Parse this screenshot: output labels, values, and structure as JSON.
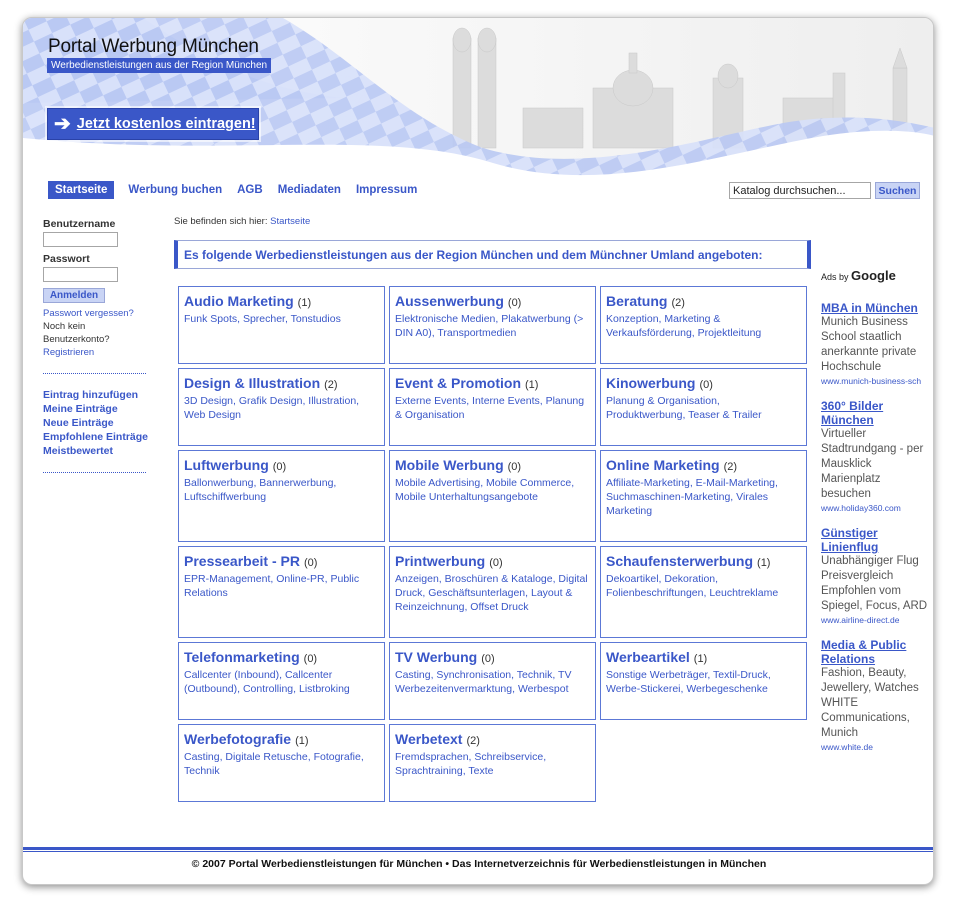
{
  "header": {
    "title": "Portal Werbung München",
    "subtitle": "Werbedienstleistungen aus der Region München",
    "cta_label": "Jetzt kostenlos eintragen!"
  },
  "nav": {
    "items": [
      "Startseite",
      "Werbung buchen",
      "AGB",
      "Mediadaten",
      "Impressum"
    ]
  },
  "search": {
    "value": "Katalog durchsuchen...",
    "button": "Suchen"
  },
  "login": {
    "username_label": "Benutzername",
    "password_label": "Passwort",
    "button": "Anmelden",
    "forgot": "Passwort vergessen?",
    "no_account": "Noch kein Benutzerkonto?",
    "register": "Registrieren"
  },
  "sidebar_links": [
    "Eintrag hinzufügen",
    "Meine Einträge",
    "Neue Einträge",
    "Empfohlene Einträge",
    "Meistbewertet"
  ],
  "breadcrumb": {
    "prefix": "Sie befinden sich hier:",
    "current": "Startseite"
  },
  "intro": "Es folgende Werbedienstleistungen aus der Region München und dem Münchner Umland angeboten:",
  "categories": [
    {
      "title": "Audio Marketing",
      "count": "(1)",
      "links": "Funk Spots, Sprecher, Tonstudios"
    },
    {
      "title": "Aussenwerbung",
      "count": "(0)",
      "links": "Elektronische Medien, Plakatwerbung (> DIN A0), Transportmedien"
    },
    {
      "title": "Beratung",
      "count": "(2)",
      "links": "Konzeption, Marketing & Verkaufsförderung, Projektleitung"
    },
    {
      "title": "Design & Illustration",
      "count": "(2)",
      "links": "3D Design, Grafik Design, Illustration, Web Design"
    },
    {
      "title": "Event & Promotion",
      "count": "(1)",
      "links": "Externe Events, Interne Events, Planung & Organisation"
    },
    {
      "title": "Kinowerbung",
      "count": "(0)",
      "links": "Planung & Organisation, Produktwerbung, Teaser & Trailer"
    },
    {
      "title": "Luftwerbung",
      "count": "(0)",
      "links": "Ballonwerbung, Bannerwerbung, Luftschiffwerbung"
    },
    {
      "title": "Mobile Werbung",
      "count": "(0)",
      "links": "Mobile Advertising, Mobile Commerce, Mobile Unterhaltungsangebote"
    },
    {
      "title": "Online Marketing",
      "count": "(2)",
      "links": "Affiliate-Marketing, E-Mail-Marketing, Suchmaschinen-Marketing, Virales Marketing"
    },
    {
      "title": "Pressearbeit - PR",
      "count": "(0)",
      "links": "EPR-Management, Online-PR, Public Relations"
    },
    {
      "title": "Printwerbung",
      "count": "(0)",
      "links": "Anzeigen, Broschüren & Kataloge, Digital Druck, Geschäftsunterlagen, Layout & Reinzeichnung, Offset Druck"
    },
    {
      "title": "Schaufensterwerbung",
      "count": "(1)",
      "links": "Dekoartikel, Dekoration, Folienbeschriftungen, Leuchtreklame"
    },
    {
      "title": "Telefonmarketing",
      "count": "(0)",
      "links": "Callcenter (Inbound), Callcenter (Outbound), Controlling, Listbroking"
    },
    {
      "title": "TV Werbung",
      "count": "(0)",
      "links": "Casting, Synchronisation, Technik, TV Werbezeitenvermarktung, Werbespot"
    },
    {
      "title": "Werbeartikel",
      "count": "(1)",
      "links": "Sonstige Werbeträger, Textil-Druck, Werbe-Stickerei, Werbegeschenke"
    },
    {
      "title": "Werbefotografie",
      "count": "(1)",
      "links": "Casting, Digitale Retusche, Fotografie, Technik"
    },
    {
      "title": "Werbetext",
      "count": "(2)",
      "links": "Fremdsprachen, Schreibservice, Sprachtraining, Texte"
    }
  ],
  "ads": {
    "label": "Ads by",
    "brand": "Google",
    "items": [
      {
        "title": "MBA in München",
        "text": "Munich Business School staatlich anerkannte private Hochschule",
        "url": "www.munich-business-sch"
      },
      {
        "title": "360° Bilder München",
        "text": "Virtueller Stadtrundgang - per Mausklick Marienplatz besuchen",
        "url": "www.holiday360.com"
      },
      {
        "title": "Günstiger Linienflug",
        "text": "Unabhängiger Flug Preisvergleich Empfohlen vom Spiegel, Focus, ARD",
        "url": "www.airline-direct.de"
      },
      {
        "title": "Media & Public Relations",
        "text": "Fashion, Beauty, Jewellery, Watches WHITE Communications, Munich",
        "url": "www.white.de"
      }
    ]
  },
  "footer": "© 2007 Portal Werbedienstleistungen für München • Das Internetverzeichnis für Werbedienstleistungen in München",
  "colors": {
    "accent": "#3a57c8",
    "light_accent": "#c9d4f5",
    "wave": "#b8c8f0"
  }
}
